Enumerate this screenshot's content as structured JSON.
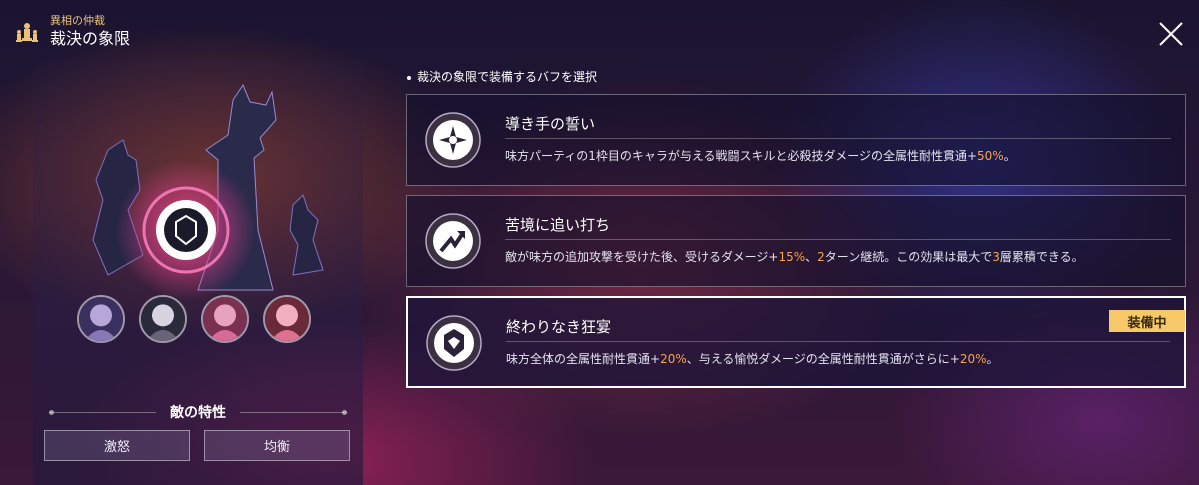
{
  "header": {
    "subtitle": "異相の仲裁",
    "title": "裁決の象限"
  },
  "left": {
    "members": [
      {
        "name": "member-1",
        "color": "#b7a6d8"
      },
      {
        "name": "member-2",
        "color": "#d9d2e0"
      },
      {
        "name": "member-3",
        "color": "#e9a2be"
      },
      {
        "name": "member-4",
        "color": "#f0b0c0"
      }
    ],
    "traits_title": "敵の特性",
    "traits": [
      "激怒",
      "均衡"
    ]
  },
  "select_label": "裁決の象限で装備するバフを選択",
  "buffs": [
    {
      "title": "導き手の誓い",
      "desc_pre": "味方パーティの1枠目のキャラが与える戦闘スキルと必殺技ダメージの全属性耐性貫通+",
      "desc_v1": "50%",
      "desc_post": "。"
    },
    {
      "title": "苦境に追い打ち",
      "desc_pre": "敵が味方の追加攻撃を受けた後、受けるダメージ+",
      "desc_v1": "15%",
      "desc_mid1": "、",
      "desc_v2": "2",
      "desc_mid2": "ターン継続。この効果は最大で",
      "desc_v3": "3",
      "desc_post": "層累積できる。"
    },
    {
      "title": "終わりなき狂宴",
      "desc_pre": "味方全体の全属性耐性貫通+",
      "desc_v1": "20%",
      "desc_mid1": "、与える愉悦ダメージの全属性耐性貫通がさらに+",
      "desc_v2": "20%",
      "desc_post": "。",
      "badge": "装備中"
    }
  ],
  "colors": {
    "highlight": "#f6a24a",
    "badge": "#f6c867",
    "header_sub": "#e9c27a"
  }
}
